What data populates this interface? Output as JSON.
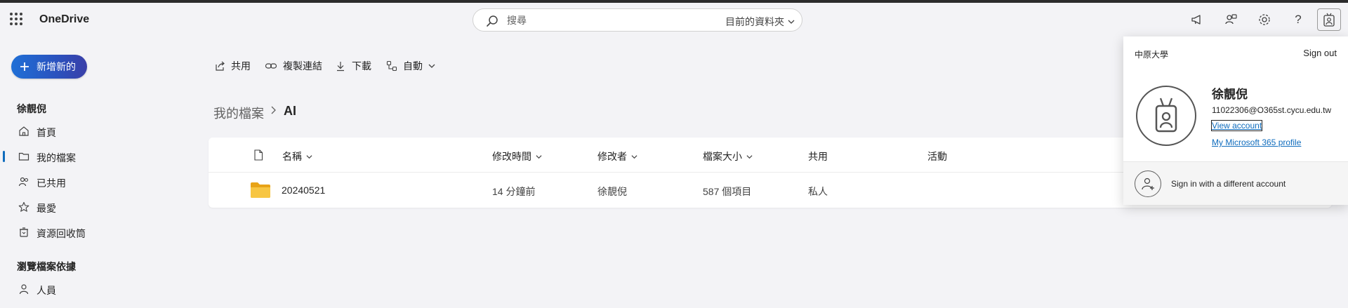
{
  "app": {
    "name": "OneDrive"
  },
  "search": {
    "placeholder": "搜尋",
    "scope": "目前的資料夾"
  },
  "header_icons": [
    "megaphone-icon",
    "share-people-icon",
    "gear-icon",
    "help-icon",
    "account-badge-icon"
  ],
  "sidebar": {
    "new_label": "新增新的",
    "user_name": "徐靚倪",
    "items": [
      {
        "label": "首頁",
        "icon": "home-icon"
      },
      {
        "label": "我的檔案",
        "icon": "folder-icon",
        "active": true
      },
      {
        "label": "已共用",
        "icon": "people-icon"
      },
      {
        "label": "最愛",
        "icon": "star-icon"
      },
      {
        "label": "資源回收筒",
        "icon": "trash-icon"
      }
    ],
    "browse_section": "瀏覽檔案依據",
    "browse_items": [
      {
        "label": "人員",
        "icon": "person-icon"
      }
    ]
  },
  "commands": {
    "share": "共用",
    "copy_link": "複製連結",
    "download": "下載",
    "automate": "自動"
  },
  "breadcrumb": {
    "root": "我的檔案",
    "current": "AI"
  },
  "table": {
    "headers": {
      "name": "名稱",
      "modified": "修改時間",
      "modified_by": "修改者",
      "size": "檔案大小",
      "sharing": "共用",
      "activity": "活動"
    },
    "rows": [
      {
        "name": "20240521",
        "modified": "14 分鐘前",
        "modified_by": "徐靚倪",
        "size": "587 個項目",
        "sharing": "私人",
        "activity": ""
      }
    ]
  },
  "account": {
    "org": "中原大學",
    "sign_out": "Sign out",
    "name": "徐靚倪",
    "email": "11022306@O365st.cycu.edu.tw",
    "view_account": "View account",
    "m365_profile": "My Microsoft 365 profile",
    "alt_sign_in": "Sign in with a different account"
  },
  "colors": {
    "accent": "#0f6cbd",
    "background": "#f3f3f6",
    "new_button": "#2a52be"
  }
}
